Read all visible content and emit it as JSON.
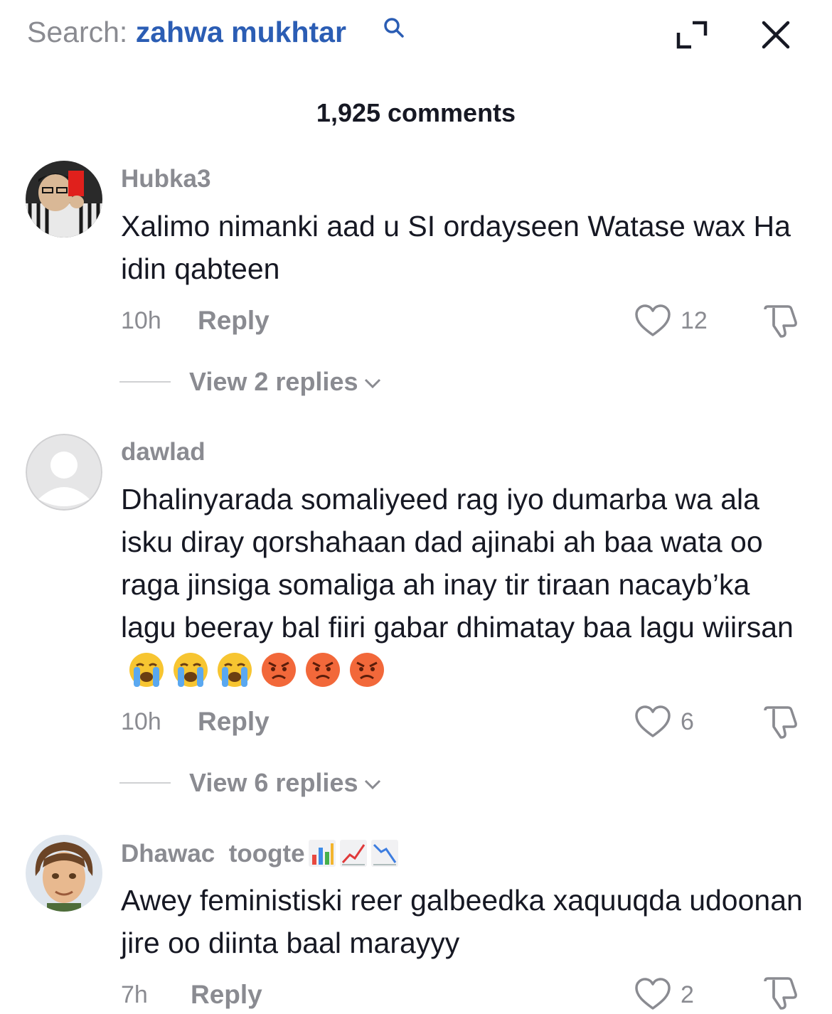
{
  "header": {
    "search_prefix": "Search:",
    "search_query": "zahwa mukhtar",
    "search_icon": "search-icon",
    "expand_icon": "expand-icon",
    "close_icon": "close-icon"
  },
  "comments_count_label": "1,925 comments",
  "comments": [
    {
      "username": "Hubka3",
      "text": "Xalimo nimanki aad u SI ordayseen Watase wax Ha idin qabteen",
      "time": "10h",
      "reply_label": "Reply",
      "likes": "12",
      "view_replies": "View 2 replies"
    },
    {
      "username": "dawlad",
      "text": "Dhalinyarada somaliyeed rag iyo dumarba wa ala isku diray qorshahaan dad ajinabi ah baa wata oo raga jinsiga somaliga ah inay tir tiraan nacayb’ka lagu beeray bal fiiri gabar dhimatay baa lagu wiirsan",
      "emojis": [
        "crying-face",
        "crying-face",
        "crying-face",
        "angry-face",
        "angry-face",
        "angry-face"
      ],
      "time": "10h",
      "reply_label": "Reply",
      "likes": "6",
      "view_replies": "View 6 replies"
    },
    {
      "username": "Dhawac  toogte",
      "badges": [
        "bar-chart",
        "chart-increasing",
        "chart-decreasing"
      ],
      "text": "Awey feministiski reer galbeedka xaquuqda udoonan jire oo diinta baal marayyy",
      "time": "7h",
      "reply_label": "Reply",
      "likes": "2"
    }
  ]
}
